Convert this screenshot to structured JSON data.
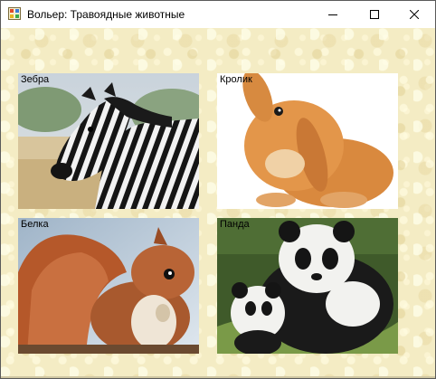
{
  "window": {
    "title": "Вольер: Травоядные животные",
    "app_icon": "winforms-app-icon",
    "controls": {
      "minimize_icon": "minimize-icon",
      "maximize_icon": "maximize-icon",
      "close_icon": "close-icon"
    }
  },
  "background_color": "#f4ecc4",
  "animals": [
    {
      "label": "Зебра"
    },
    {
      "label": "Кролик"
    },
    {
      "label": "Белка"
    },
    {
      "label": "Панда"
    }
  ]
}
